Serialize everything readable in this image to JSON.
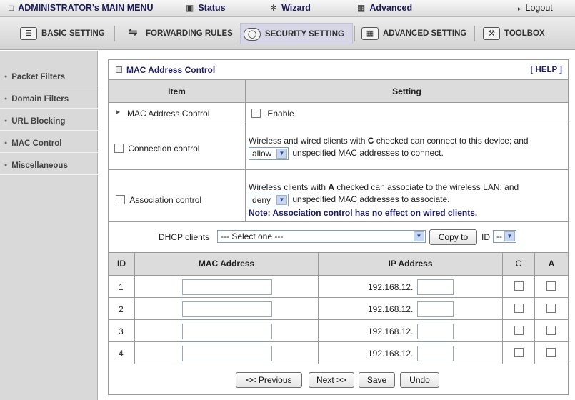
{
  "top_menu": {
    "admin": "ADMINISTRATOR's MAIN MENU",
    "status": "Status",
    "wizard": "Wizard",
    "advanced": "Advanced",
    "logout": "Logout"
  },
  "nav": {
    "basic": "BASIC SETTING",
    "forwarding": "FORWARDING RULES",
    "security": "SECURITY SETTING",
    "advanced": "ADVANCED SETTING",
    "toolbox": "TOOLBOX"
  },
  "sidebar": {
    "items": [
      {
        "label": "Packet Filters"
      },
      {
        "label": "Domain Filters"
      },
      {
        "label": "URL Blocking"
      },
      {
        "label": "MAC Control"
      },
      {
        "label": "Miscellaneous"
      }
    ]
  },
  "panel": {
    "title": "MAC Address Control",
    "help": "[ HELP ]",
    "col_item": "Item",
    "col_setting": "Setting",
    "row_mac_label": "MAC Address Control",
    "enable_label": "Enable",
    "conn_label": "Connection control",
    "conn_text_pre": "Wireless and wired clients with ",
    "conn_key": "C",
    "conn_text_post": " checked can connect to this device; and",
    "conn_select": "allow",
    "conn_text2": "unspecified MAC addresses to connect.",
    "assoc_label": "Association control",
    "assoc_text_pre": "Wireless clients with ",
    "assoc_key": "A",
    "assoc_text_post": " checked can associate to the wireless LAN; and",
    "assoc_select": "deny",
    "assoc_text2": "unspecified MAC addresses to associate.",
    "assoc_note": "Note: Association control has no effect on wired clients.",
    "dhcp_label": "DHCP clients",
    "dhcp_select": "--- Select one ---",
    "copy_button": "Copy to",
    "id_label": "ID",
    "id_select": "--"
  },
  "table": {
    "headers": [
      "ID",
      "MAC Address",
      "IP Address",
      "C",
      "A"
    ],
    "ip_prefix": "192.168.12.",
    "rows": [
      {
        "id": "1"
      },
      {
        "id": "2"
      },
      {
        "id": "3"
      },
      {
        "id": "4"
      }
    ]
  },
  "buttons": {
    "previous": "<< Previous",
    "next": "Next >>",
    "save": "Save",
    "undo": "Undo"
  }
}
